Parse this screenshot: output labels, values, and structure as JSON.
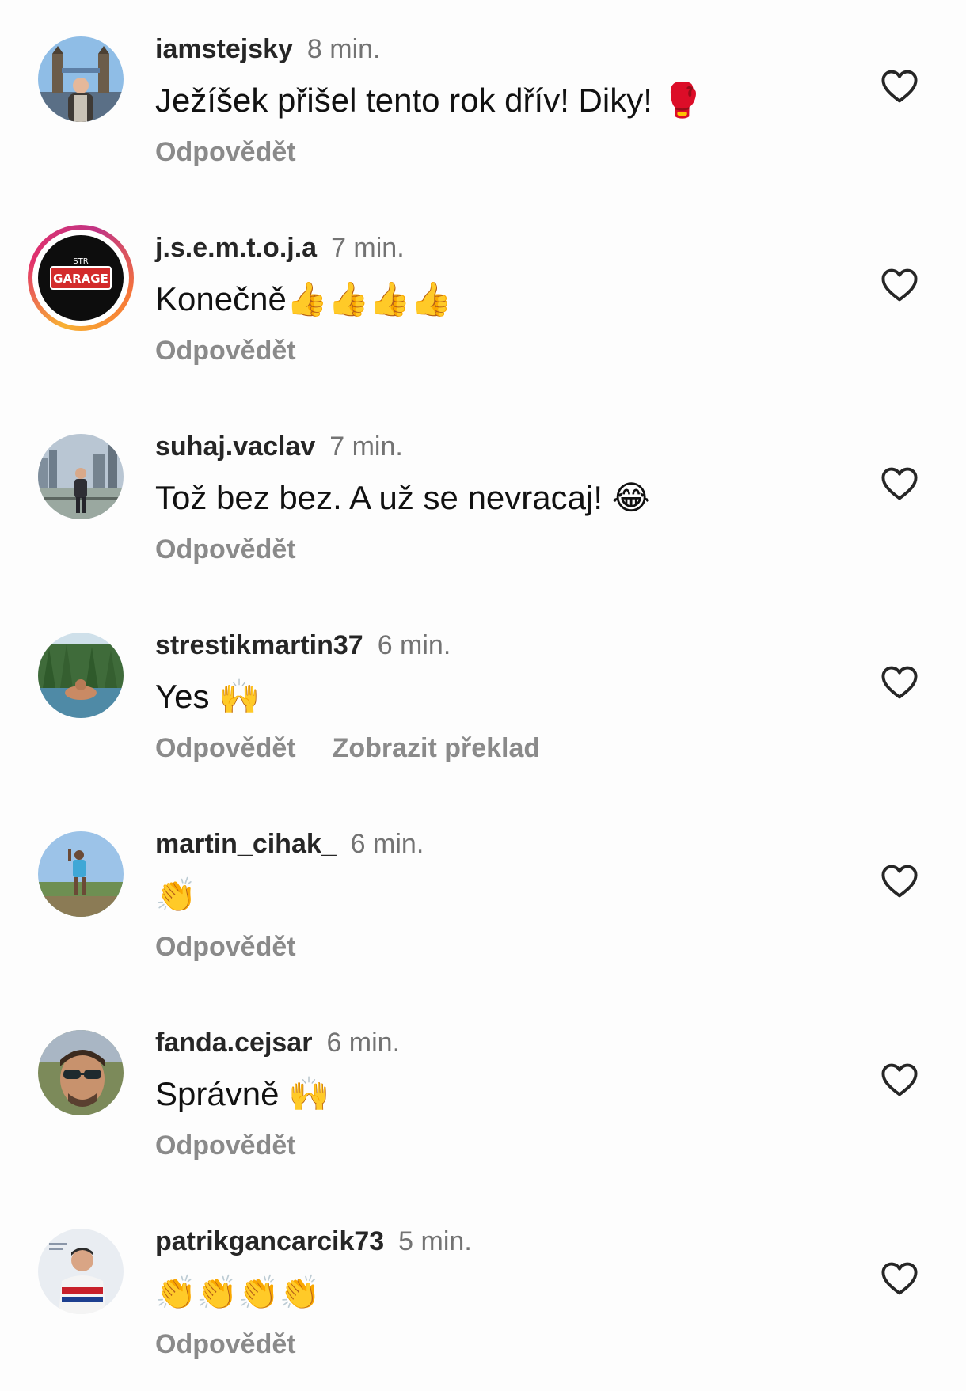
{
  "comments": [
    {
      "username": "iamstejsky",
      "time": "8 min.",
      "text": "Ježíšek přišel tento rok dřív! Diky! 🥊",
      "reply_label": "Odpovědět"
    },
    {
      "username": "j.s.e.m.t.o.j.a",
      "time": "7 min.",
      "text": "Konečně👍👍👍👍",
      "reply_label": "Odpovědět",
      "avatar_text": "GARAGE"
    },
    {
      "username": "suhaj.vaclav",
      "time": "7 min.",
      "text": "Tož bez bez. A už se nevracaj! 😂",
      "reply_label": "Odpovědět"
    },
    {
      "username": "strestikmartin37",
      "time": "6 min.",
      "text": "Yes 🙌",
      "reply_label": "Odpovědět",
      "translate_label": "Zobrazit překlad"
    },
    {
      "username": "martin_cihak_",
      "time": "6 min.",
      "text": "👏",
      "reply_label": "Odpovědět"
    },
    {
      "username": "fanda.cejsar",
      "time": "6 min.",
      "text": "Správně 🙌",
      "reply_label": "Odpovědět"
    },
    {
      "username": "patrikgancarcik73",
      "time": "5 min.",
      "text": "👏👏👏👏",
      "reply_label": "Odpovědět"
    }
  ],
  "icons": {
    "like": "heart-outline-icon"
  },
  "colors": {
    "background": "#fdfdfd",
    "username": "#262626",
    "time": "#737373",
    "action": "#8a8a8a",
    "heart": "#262626"
  }
}
